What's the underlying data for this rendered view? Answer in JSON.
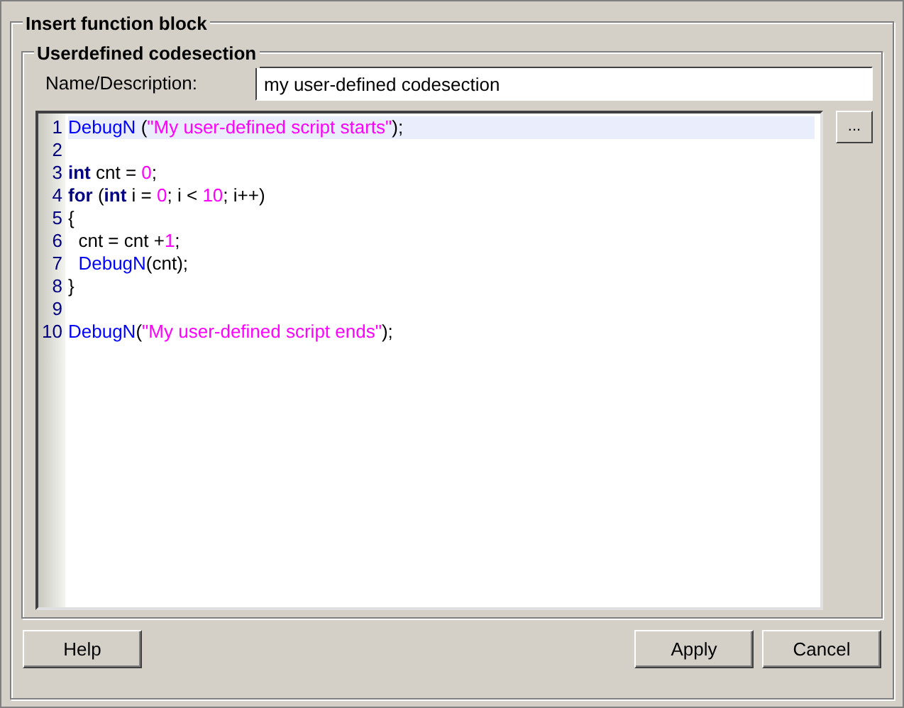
{
  "outer_group": {
    "title": "Insert function block"
  },
  "inner_group": {
    "title": "Userdefined codesection"
  },
  "name_field": {
    "label": "Name/Description:",
    "value": "my user-defined codesection"
  },
  "browse_button": {
    "label": "..."
  },
  "code_editor": {
    "lines": [
      {
        "number": "1",
        "highlighted": true,
        "tokens": [
          {
            "kind": "function",
            "text": "DebugN"
          },
          {
            "kind": "plain",
            "text": " ("
          },
          {
            "kind": "string",
            "text": "\"My user-defined script starts\""
          },
          {
            "kind": "plain",
            "text": ");"
          }
        ]
      },
      {
        "number": "2",
        "highlighted": false
      },
      {
        "number": "3",
        "highlighted": false,
        "tokens": [
          {
            "kind": "keyword",
            "text": "int"
          },
          {
            "kind": "plain",
            "text": " cnt = "
          },
          {
            "kind": "number",
            "text": "0"
          },
          {
            "kind": "plain",
            "text": ";"
          }
        ]
      },
      {
        "number": "4",
        "highlighted": false,
        "tokens": [
          {
            "kind": "keyword",
            "text": "for"
          },
          {
            "kind": "plain",
            "text": " ("
          },
          {
            "kind": "keyword",
            "text": "int"
          },
          {
            "kind": "plain",
            "text": " i = "
          },
          {
            "kind": "number",
            "text": "0"
          },
          {
            "kind": "plain",
            "text": "; i < "
          },
          {
            "kind": "number",
            "text": "10"
          },
          {
            "kind": "plain",
            "text": "; i++)"
          }
        ]
      },
      {
        "number": "5",
        "highlighted": false,
        "tokens": [
          {
            "kind": "plain",
            "text": "{"
          }
        ]
      },
      {
        "number": "6",
        "highlighted": false,
        "tokens": [
          {
            "kind": "plain",
            "text": "  cnt = cnt +"
          },
          {
            "kind": "number",
            "text": "1"
          },
          {
            "kind": "plain",
            "text": ";"
          }
        ]
      },
      {
        "number": "7",
        "highlighted": false,
        "tokens": [
          {
            "kind": "function",
            "text": "  DebugN"
          },
          {
            "kind": "plain",
            "text": "(cnt);"
          }
        ]
      },
      {
        "number": "8",
        "highlighted": false,
        "tokens": [
          {
            "kind": "plain",
            "text": "}"
          }
        ]
      },
      {
        "number": "9",
        "highlighted": false
      },
      {
        "number": "10",
        "highlighted": false,
        "tokens": [
          {
            "kind": "function",
            "text": "DebugN"
          },
          {
            "kind": "plain",
            "text": "("
          },
          {
            "kind": "string",
            "text": "\"My user-defined script ends\""
          },
          {
            "kind": "plain",
            "text": ");"
          }
        ]
      }
    ]
  },
  "buttons_left": [
    "Help"
  ],
  "buttons_right": [
    "Apply",
    "Cancel"
  ]
}
